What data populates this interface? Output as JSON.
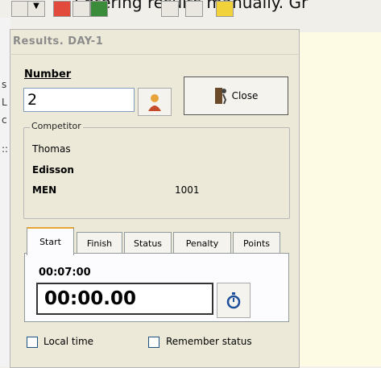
{
  "caption": "Entering results manually. Gr",
  "dialog": {
    "title": "Results. DAY-1",
    "number_label": "Number",
    "number_value": "2",
    "close_label": "Close"
  },
  "competitor": {
    "legend": "Competitor",
    "first_name": "Thomas",
    "last_name": "Edisson",
    "class": "MEN",
    "bib": "1001"
  },
  "tabs": [
    {
      "label": "Start",
      "active": true
    },
    {
      "label": "Finish",
      "active": false
    },
    {
      "label": "Status",
      "active": false
    },
    {
      "label": "Penalty",
      "active": false
    },
    {
      "label": "Points",
      "active": false
    }
  ],
  "start_tab": {
    "start_time": "00:07:00",
    "time_value": "00:00.00"
  },
  "options": {
    "local_time_label": "Local time",
    "local_time_checked": false,
    "remember_status_label": "Remember status",
    "remember_status_checked": false
  },
  "side_chars": [
    "s",
    "L",
    "c",
    "::"
  ],
  "colors": {
    "accent_tab": "#e7a534",
    "panel_yellow": "#fdfbe3",
    "dialog_bg": "#ece9d8"
  }
}
